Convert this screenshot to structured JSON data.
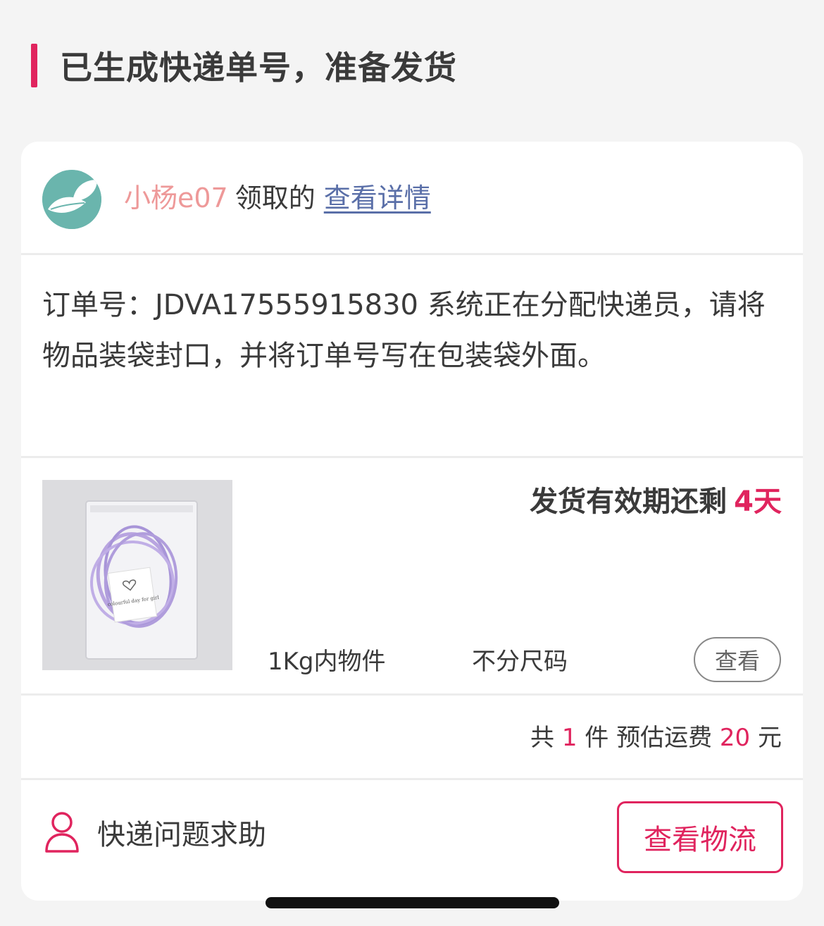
{
  "header": {
    "title": "已生成快递单号，准备发货",
    "accent_color": "#e0245e"
  },
  "user": {
    "avatar_icon": "leaf-avatar-icon",
    "name": "小杨e07",
    "action": "领取的",
    "detail_link": "查看详情"
  },
  "order": {
    "message": "订单号：JDVA17555915830 系统正在分配快递员，请将物品装袋封口，并将订单号写在包装袋外面。"
  },
  "item": {
    "image_label": "colourful day for girl",
    "deadline_label": "发货有效期还剩",
    "deadline_days": "4天",
    "weight": "1Kg内物件",
    "size": "不分尺码",
    "view_button": "查看"
  },
  "summary": {
    "count_prefix": "共",
    "count": "1",
    "count_unit": "件",
    "fee_label": "预估运费",
    "fee": "20",
    "fee_unit": "元"
  },
  "footer": {
    "help_icon": "person-icon",
    "help_label": "快递问题求助",
    "logistics_button": "查看物流"
  }
}
